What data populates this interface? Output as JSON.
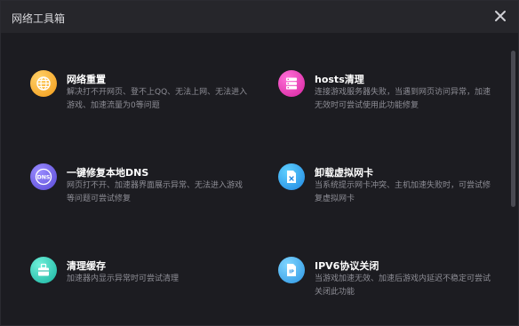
{
  "window": {
    "title": "网络工具箱"
  },
  "tools": [
    {
      "name": "网络重置",
      "desc": "解决打不开网页、登不上QQ、无法上网、无法进入游戏、加速流量为0等问题",
      "icon": "globe-icon",
      "color": "#f5a623"
    },
    {
      "name": "hosts清理",
      "desc": "连接游戏服务器失败，当遇到网页访问异常，加速无效时可尝试使用此功能修复",
      "icon": "server-icon",
      "color": "#e23fb3"
    },
    {
      "name": "一键修复本地DNS",
      "desc": "网页打不开、加速器界面展示异常、无法进入游戏等问题可尝试修复",
      "icon": "dns-icon",
      "color": "#6b63e0"
    },
    {
      "name": "卸载虚拟网卡",
      "desc": "当系统提示网卡冲突、主机加速失败时，可尝试修复虚拟网卡",
      "icon": "network-card-icon",
      "color": "#2f9be8"
    },
    {
      "name": "清理缓存",
      "desc": "加速器内显示异常时可尝试清理",
      "icon": "cache-clean-icon",
      "color": "#24c6b3"
    },
    {
      "name": "IPV6协议关闭",
      "desc": "当游戏加速无效、加速后游戏内延迟不稳定可尝试关闭此功能",
      "icon": "ip-file-icon",
      "color": "#3aa8e8"
    }
  ]
}
